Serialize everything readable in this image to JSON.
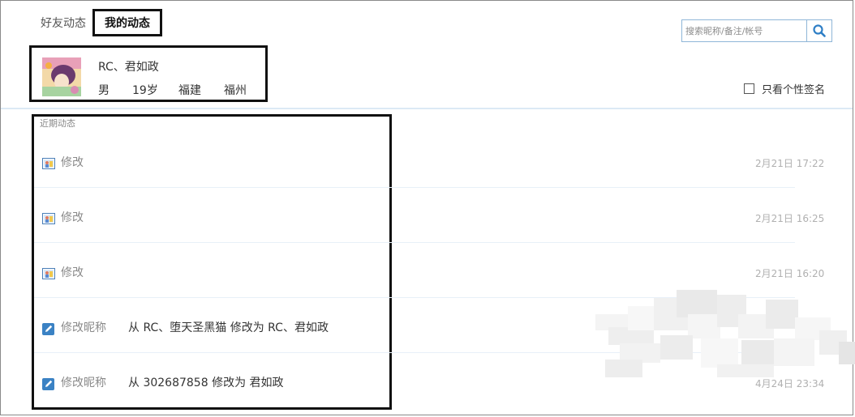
{
  "tabs": [
    {
      "label": "好友动态",
      "active": false
    },
    {
      "label": "我的动态",
      "active": true
    }
  ],
  "search": {
    "placeholder": "搜索昵称/备注/帐号",
    "icon": "search-icon"
  },
  "profile": {
    "name": "RC、君如政",
    "gender": "男",
    "age": "19岁",
    "province": "福建",
    "city": "福州"
  },
  "filter": {
    "label": "只看个性签名",
    "checked": false
  },
  "feed": {
    "section_label": "近期动态",
    "items": [
      {
        "icon": "avatar-update-icon",
        "label": "修改",
        "detail": "",
        "time": "2月21日 17:22"
      },
      {
        "icon": "avatar-update-icon",
        "label": "修改",
        "detail": "",
        "time": "2月21日 16:25"
      },
      {
        "icon": "avatar-update-icon",
        "label": "修改",
        "detail": "",
        "time": "2月21日 16:20"
      },
      {
        "icon": "edit-icon",
        "label": "修改昵称",
        "detail": "从 RC、堕天圣黑猫 修改为 RC、君如政",
        "time": ""
      },
      {
        "icon": "edit-icon",
        "label": "修改昵称",
        "detail": "从 302687858 修改为 君如政",
        "time": "4月24日 23:34"
      }
    ]
  },
  "colors": {
    "accent": "#3b82c4",
    "border_dark": "#111111",
    "divider": "#dce9f5",
    "muted_text": "#8a8a8a",
    "time_text": "#b0b0b0"
  }
}
